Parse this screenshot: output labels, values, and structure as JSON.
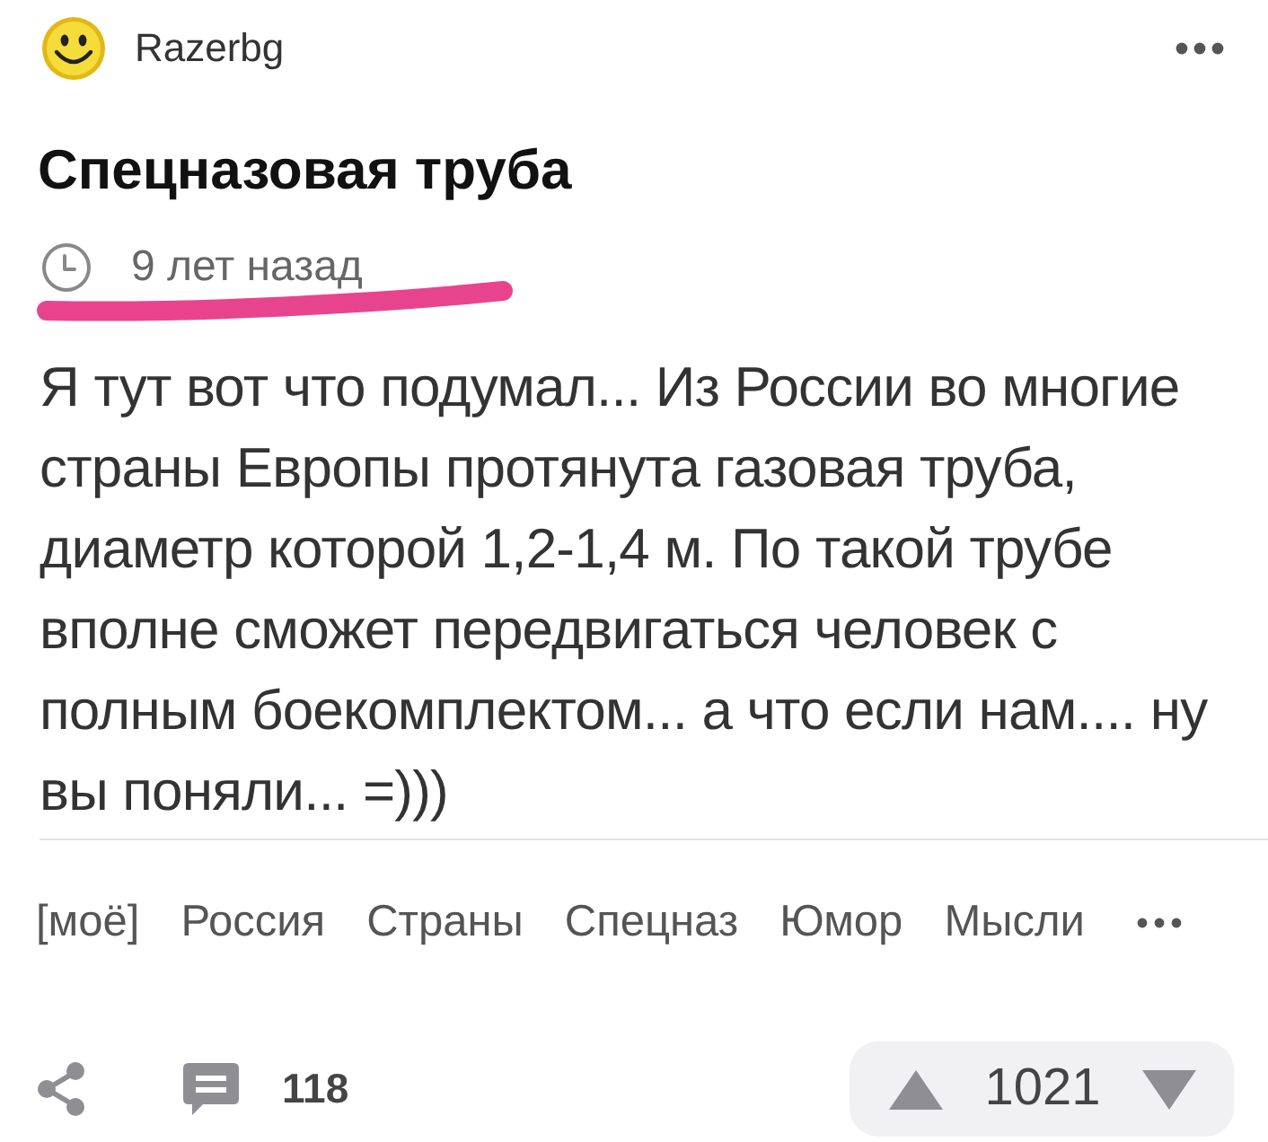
{
  "post": {
    "author": "Razerbg",
    "title": "Спецназовая труба",
    "time": "9 лет назад",
    "body": "Я тут вот что подумал... Из России во многие страны Европы протянута газовая труба, диаметр которой 1,2-1,4 м. По такой трубе вполне сможет передвигаться человек с полным боекомплектом... а что если нам.... ну вы поняли... =)))"
  },
  "tags": [
    "[моё]",
    "Россия",
    "Страны",
    "Спецназ",
    "Юмор",
    "Мысли"
  ],
  "footer": {
    "comments": "118",
    "rating": "1021"
  }
}
